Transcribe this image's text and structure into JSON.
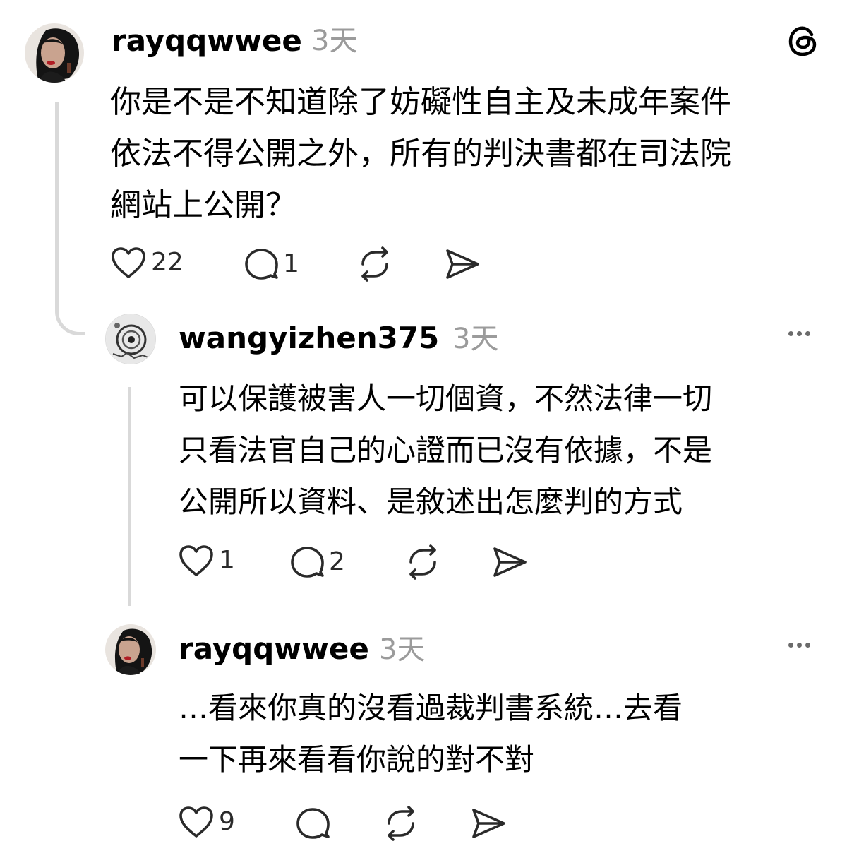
{
  "app_logo": "threads-logo-icon",
  "comments": [
    {
      "username": "rayqqwwee",
      "time": "3天",
      "lines": [
        "你是不是不知道除了妨礙性自主及未成年案件",
        "依法不得公開之外，所有的判決書都在司法院",
        "網站上公開？"
      ],
      "likes": "22",
      "replies": "1"
    },
    {
      "username": "wangyizhen375",
      "time": "3天",
      "lines": [
        "可以保護被害人一切個資，不然法律一切",
        "只看法官自己的心證而已沒有依據，不是",
        "公開所以資料、是敘述出怎麼判的方式"
      ],
      "likes": "1",
      "replies": "2"
    },
    {
      "username": "rayqqwwee",
      "time": "3天",
      "lines": [
        "…看來你真的沒看過裁判書系統…去看",
        "一下再來看看你說的對不對"
      ],
      "likes": "9",
      "replies": ""
    }
  ],
  "icons": [
    "heart-icon",
    "comment-icon",
    "repost-icon",
    "share-icon",
    "more-options-icon"
  ],
  "colors": {
    "text": "#000000",
    "muted": "#9b9b9b",
    "thread_line": "#d9d9d9",
    "icon": "#2a2a2a"
  }
}
